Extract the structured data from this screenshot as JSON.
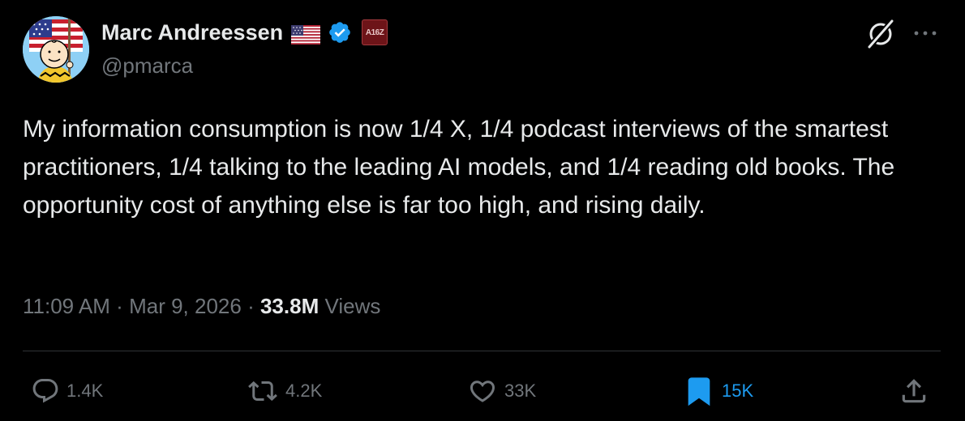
{
  "author": {
    "display_name": "Marc Andreessen",
    "handle": "@pmarca",
    "flag": "us-flag-icon",
    "verified": true,
    "verified_color": "#1d9bf0",
    "affiliate_badge": "A16Z"
  },
  "tweet": {
    "text": "My information consumption is now 1/4 X, 1/4 podcast interviews of the smartest practitioners, 1/4 talking to the leading AI models, and 1/4 reading old books. The opportunity cost of anything else is far too high, and rising daily."
  },
  "meta": {
    "time": "11:09 AM",
    "separator": "·",
    "date": "Mar 9, 2026",
    "views_count": "33.8M",
    "views_label": "Views"
  },
  "actions": {
    "reply_count": "1.4K",
    "repost_count": "4.2K",
    "like_count": "33K",
    "bookmark_count": "15K"
  },
  "colors": {
    "background": "#000000",
    "text": "#e7e9ea",
    "muted": "#71767b",
    "accent": "#1d9bf0",
    "divider": "#2f3336"
  }
}
